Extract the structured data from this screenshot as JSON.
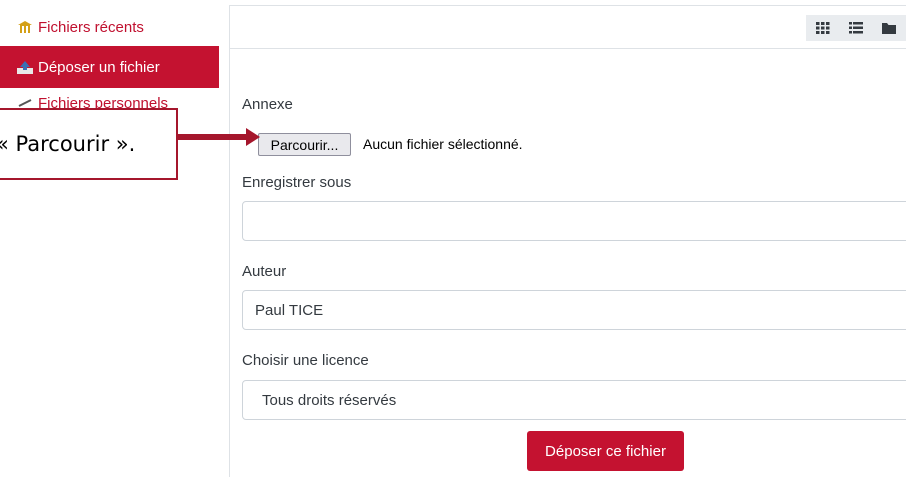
{
  "sidebar": {
    "items": [
      {
        "label": "Fichiers récents",
        "icon": "recent-files-icon"
      },
      {
        "label": "Déposer un fichier",
        "icon": "upload-icon"
      },
      {
        "label": "Fichiers personnels",
        "icon": "personal-files-icon"
      }
    ]
  },
  "callout": {
    "text": "« Parcourir »."
  },
  "toolbar": {
    "views": [
      "grid-view-icon",
      "list-view-icon",
      "tree-view-icon"
    ]
  },
  "form": {
    "attachment_label": "Annexe",
    "browse_label": "Parcourir...",
    "no_file_text": "Aucun fichier sélectionné.",
    "save_as_label": "Enregistrer sous",
    "save_as_value": "",
    "author_label": "Auteur",
    "author_value": "Paul TICE",
    "license_label": "Choisir une licence",
    "license_value": "Tous droits réservés",
    "submit_label": "Déposer ce fichier"
  },
  "colors": {
    "accent": "#c41230",
    "callout_border": "#a5162c"
  }
}
